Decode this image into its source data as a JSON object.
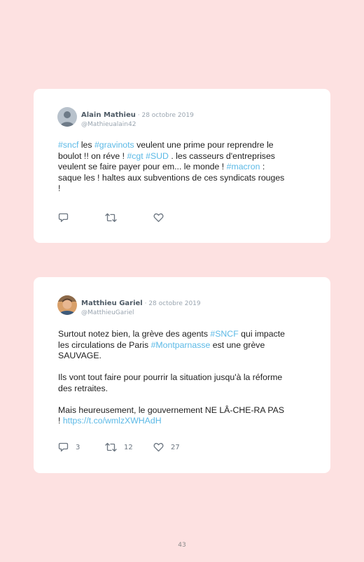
{
  "tweets": [
    {
      "author": "Alain Mathieu",
      "separator": " · ",
      "date": "28 octobre 2019",
      "handle": "@Mathieualain42",
      "segments": [
        {
          "t": "ht",
          "v": "#sncf"
        },
        {
          "t": "tx",
          "v": " les "
        },
        {
          "t": "ht",
          "v": "#gravinots"
        },
        {
          "t": "tx",
          "v": " veulent une prime pour reprendre le"
        },
        {
          "t": "br"
        },
        {
          "t": "tx",
          "v": "boulot !! on réve ! "
        },
        {
          "t": "ht",
          "v": "#cgt"
        },
        {
          "t": "tx",
          "v": " "
        },
        {
          "t": "ht",
          "v": "#SUD"
        },
        {
          "t": "tx",
          "v": " . les casseurs d'entreprises"
        },
        {
          "t": "br"
        },
        {
          "t": "tx",
          "v": "veulent se faire payer pour em... le monde ! "
        },
        {
          "t": "ht",
          "v": "#macron"
        },
        {
          "t": "tx",
          "v": " :"
        },
        {
          "t": "br"
        },
        {
          "t": "tx",
          "v": "saque les ! haltes aux subventions de ces syndicats rouges"
        },
        {
          "t": "br"
        },
        {
          "t": "tx",
          "v": "!"
        }
      ],
      "actions": {
        "reply": "",
        "retweet": "",
        "like": ""
      }
    },
    {
      "author": "Matthieu Gariel",
      "separator": " · ",
      "date": "28 octobre 2019",
      "handle": "@MatthieuGariel",
      "segments": [
        {
          "t": "tx",
          "v": "Surtout notez bien, la grève des agents "
        },
        {
          "t": "ht",
          "v": "#SNCF"
        },
        {
          "t": "tx",
          "v": " qui impacte"
        },
        {
          "t": "br"
        },
        {
          "t": "tx",
          "v": "les circulations de Paris "
        },
        {
          "t": "ht",
          "v": "#Montparnasse"
        },
        {
          "t": "tx",
          "v": " est une grève"
        },
        {
          "t": "br"
        },
        {
          "t": "tx",
          "v": "SAUVAGE."
        },
        {
          "t": "gap"
        },
        {
          "t": "tx",
          "v": "Ils vont tout faire pour pourrir la situation jusqu'à la réforme"
        },
        {
          "t": "br"
        },
        {
          "t": "tx",
          "v": "des retraites."
        },
        {
          "t": "gap"
        },
        {
          "t": "tx",
          "v": "Mais heureusement, le gouvernement NE LÂ-CHE-RA PAS"
        },
        {
          "t": "br"
        },
        {
          "t": "tx",
          "v": "! "
        },
        {
          "t": "lnk",
          "v": "https://t.co/wmlzXWHAdH"
        }
      ],
      "actions": {
        "reply": "3",
        "retweet": "12",
        "like": "27"
      }
    }
  ],
  "page_number": "43",
  "colors": {
    "background": "#fde1e1",
    "hashtag": "#5bb9e6",
    "name": "#4f5b66",
    "meta": "#9aa5b0"
  },
  "icons": {
    "reply": "reply-icon",
    "retweet": "retweet-icon",
    "like": "heart-icon"
  }
}
